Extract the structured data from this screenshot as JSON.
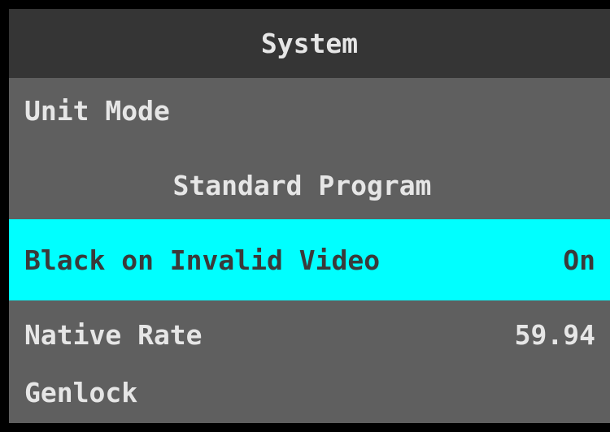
{
  "header": {
    "title": "System"
  },
  "menu": {
    "unit_mode": {
      "label": "Unit Mode"
    },
    "unit_mode_value": "Standard Program",
    "black_on_invalid": {
      "label": "Black on Invalid Video",
      "value": "On"
    },
    "native_rate": {
      "label": "Native Rate",
      "value": "59.94"
    },
    "genlock": {
      "label": "Genlock"
    }
  },
  "colors": {
    "panel_bg": "#5f5f5f",
    "header_bg": "#353535",
    "highlight_bg": "#00ffff",
    "text": "#e6e6e6",
    "highlight_text": "#3a3a3a",
    "border": "#000000"
  }
}
